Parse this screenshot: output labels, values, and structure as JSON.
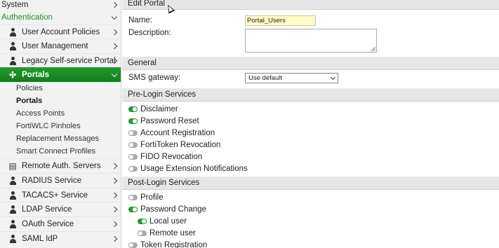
{
  "sidebar": {
    "system": "System",
    "authentication": "Authentication",
    "groups_top": [
      {
        "label": "User Account Policies",
        "icon": "user-lock-icon"
      },
      {
        "label": "User Management",
        "icon": "user-gear-icon"
      },
      {
        "label": "Legacy Self-service Portal",
        "icon": "user-gear-icon"
      }
    ],
    "portals": {
      "label": "Portals",
      "icon": "portal-icon"
    },
    "portal_items": [
      "Policies",
      "Portals",
      "Access Points",
      "FortiWLC Pinholes",
      "Replacement Messages",
      "Smart Connect Profiles"
    ],
    "groups_bottom": [
      {
        "label": "Remote Auth. Servers",
        "icon": "server-icon"
      },
      {
        "label": "RADIUS Service",
        "icon": "user-gear-icon"
      },
      {
        "label": "TACACS+ Service",
        "icon": "user-gear-icon"
      },
      {
        "label": "LDAP Service",
        "icon": "user-icon"
      },
      {
        "label": "OAuth Service",
        "icon": "user-lock-icon"
      },
      {
        "label": "SAML IdP",
        "icon": "user-icon"
      }
    ]
  },
  "main": {
    "title": "Edit Portal",
    "name_label": "Name:",
    "name_value": "Portal_Users",
    "description_label": "Description:",
    "description_value": "",
    "general_header": "General",
    "sms_label": "SMS gateway:",
    "sms_value": "Use default",
    "pre_login_header": "Pre-Login Services",
    "pre_login": [
      {
        "label": "Disclaimer",
        "on": true
      },
      {
        "label": "Password Reset",
        "on": true
      },
      {
        "label": "Account Registration",
        "on": false
      },
      {
        "label": "FortiToken Revocation",
        "on": false
      },
      {
        "label": "FIDO Revocation",
        "on": false
      },
      {
        "label": "Usage Extension Notifications",
        "on": false
      }
    ],
    "post_login_header": "Post-Login Services",
    "post_login": [
      {
        "label": "Profile",
        "on": false,
        "indent": false
      },
      {
        "label": "Password Change",
        "on": true,
        "indent": false
      },
      {
        "label": "Local user",
        "on": true,
        "indent": true
      },
      {
        "label": "Remote user",
        "on": false,
        "indent": true
      },
      {
        "label": "Token Registration",
        "on": false,
        "indent": false
      }
    ]
  },
  "colors": {
    "accent": "#1f9d2a",
    "section_header": "#e6e6e6",
    "input_highlight": "#fffbc8"
  }
}
